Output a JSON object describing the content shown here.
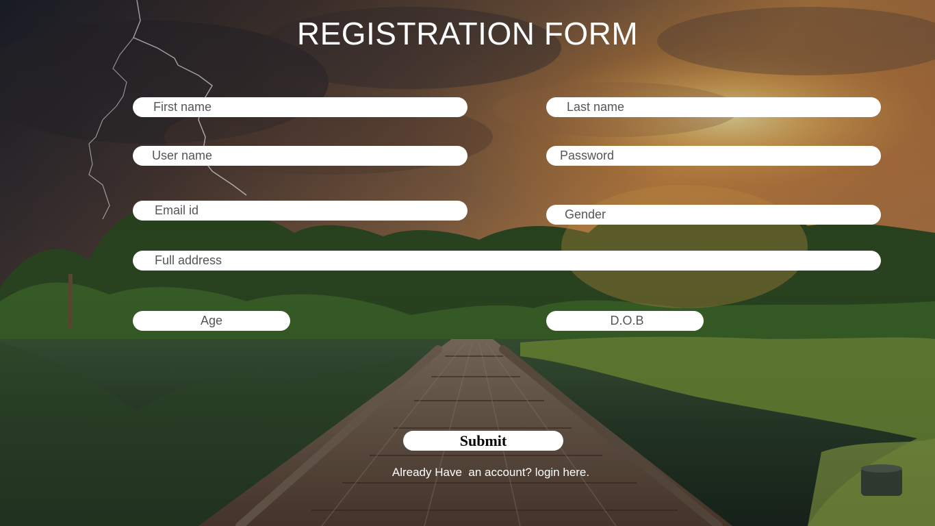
{
  "page": {
    "title": "REGISTRATION FORM"
  },
  "form": {
    "first_name": {
      "placeholder": "First name"
    },
    "last_name": {
      "placeholder": "Last name"
    },
    "user_name": {
      "placeholder": "User name"
    },
    "password": {
      "placeholder": "Password"
    },
    "email": {
      "placeholder": "Email id"
    },
    "gender": {
      "placeholder": "Gender"
    },
    "full_address": {
      "placeholder": "Full address"
    },
    "age": {
      "placeholder": "Age"
    },
    "dob": {
      "placeholder": "D.O.B"
    },
    "submit_label": "Submit",
    "login_prompt": "Already Have  an account? login here."
  },
  "colors": {
    "field_background": "#ffffff",
    "field_text": "#555555",
    "title_text": "#ffffff"
  }
}
